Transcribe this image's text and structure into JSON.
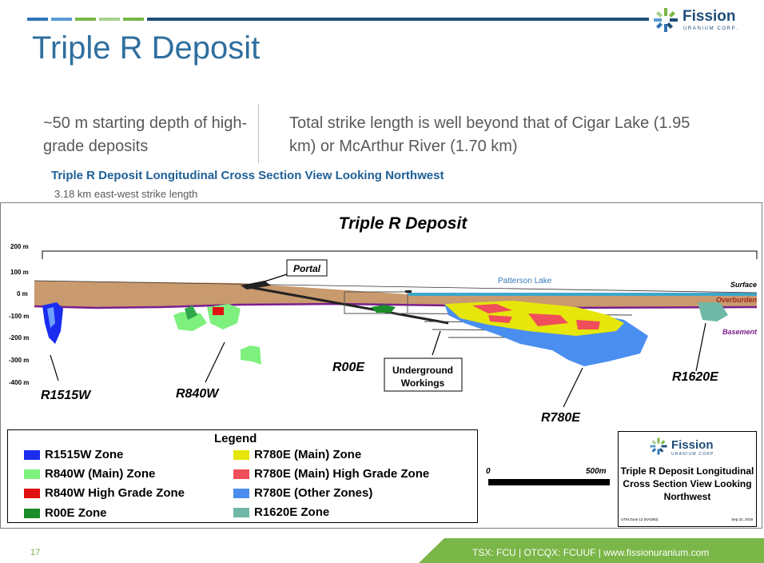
{
  "header": {
    "title": "Triple R Deposit",
    "logo_word": "Fission",
    "logo_sub": "URANIUM CORP."
  },
  "bullets": {
    "left": "~50 m starting depth of high-grade deposits",
    "right": "Total strike length is well beyond that of Cigar Lake (1.95 km) or McArthur River (1.70 km)"
  },
  "section": {
    "heading": "Triple R Deposit Longitudinal Cross Section View Looking Northwest",
    "note": "3.18 km east-west strike length"
  },
  "figure": {
    "title": "Triple R Deposit",
    "elevation_labels": [
      "200 m",
      "100 m",
      "0 m",
      "-100 m",
      "-200 m",
      "-300 m",
      "-400 m"
    ],
    "labels": {
      "portal": "Portal",
      "patterson_lake": "Patterson Lake",
      "surface": "Surface",
      "overburden": "Overburden",
      "basement": "Basement",
      "underground": "Underground",
      "workings": "Workings"
    },
    "zones": {
      "r1515w": "R1515W",
      "r840w": "R840W",
      "r00e": "R00E",
      "r780e": "R780E",
      "r1620e": "R1620E"
    },
    "legend": {
      "title": "Legend",
      "items": [
        {
          "label": "R1515W Zone",
          "color": "#1a2cf0"
        },
        {
          "label": "R840W (Main) Zone",
          "color": "#7ef07e"
        },
        {
          "label": "R840W High Grade Zone",
          "color": "#e01010"
        },
        {
          "label": "R00E Zone",
          "color": "#1a8c2a"
        },
        {
          "label": "R780E (Main) Zone",
          "color": "#e6e60a"
        },
        {
          "label": "R780E (Main) High Grade Zone",
          "color": "#f04e5a"
        },
        {
          "label": "R780E (Other Zones)",
          "color": "#4a8ef0"
        },
        {
          "label": "R1620E Zone",
          "color": "#6fb8a6"
        }
      ]
    },
    "scale": {
      "start": "0",
      "end": "500m"
    },
    "caption_box": {
      "logo_word": "Fission",
      "logo_sub": "URANIUM CORP.",
      "caption": "Triple R Deposit Longitudinal Cross Section View Looking Northwest",
      "foot_left": "UTM Zone 12 (NAD83)",
      "foot_right": "Sep 22, 2019"
    }
  },
  "footer": {
    "page": "17",
    "text": "TSX: FCU  |  OTCQX: FCUUF | www.fissionuranium.com"
  },
  "colors": {
    "brand_blue": "#1f4e79",
    "title_blue": "#2f6f9f",
    "footer_green": "#7ab648",
    "overburden": "#c99a6e",
    "basement_line": "#7a1f8c",
    "lake": "#3ea7c8"
  }
}
